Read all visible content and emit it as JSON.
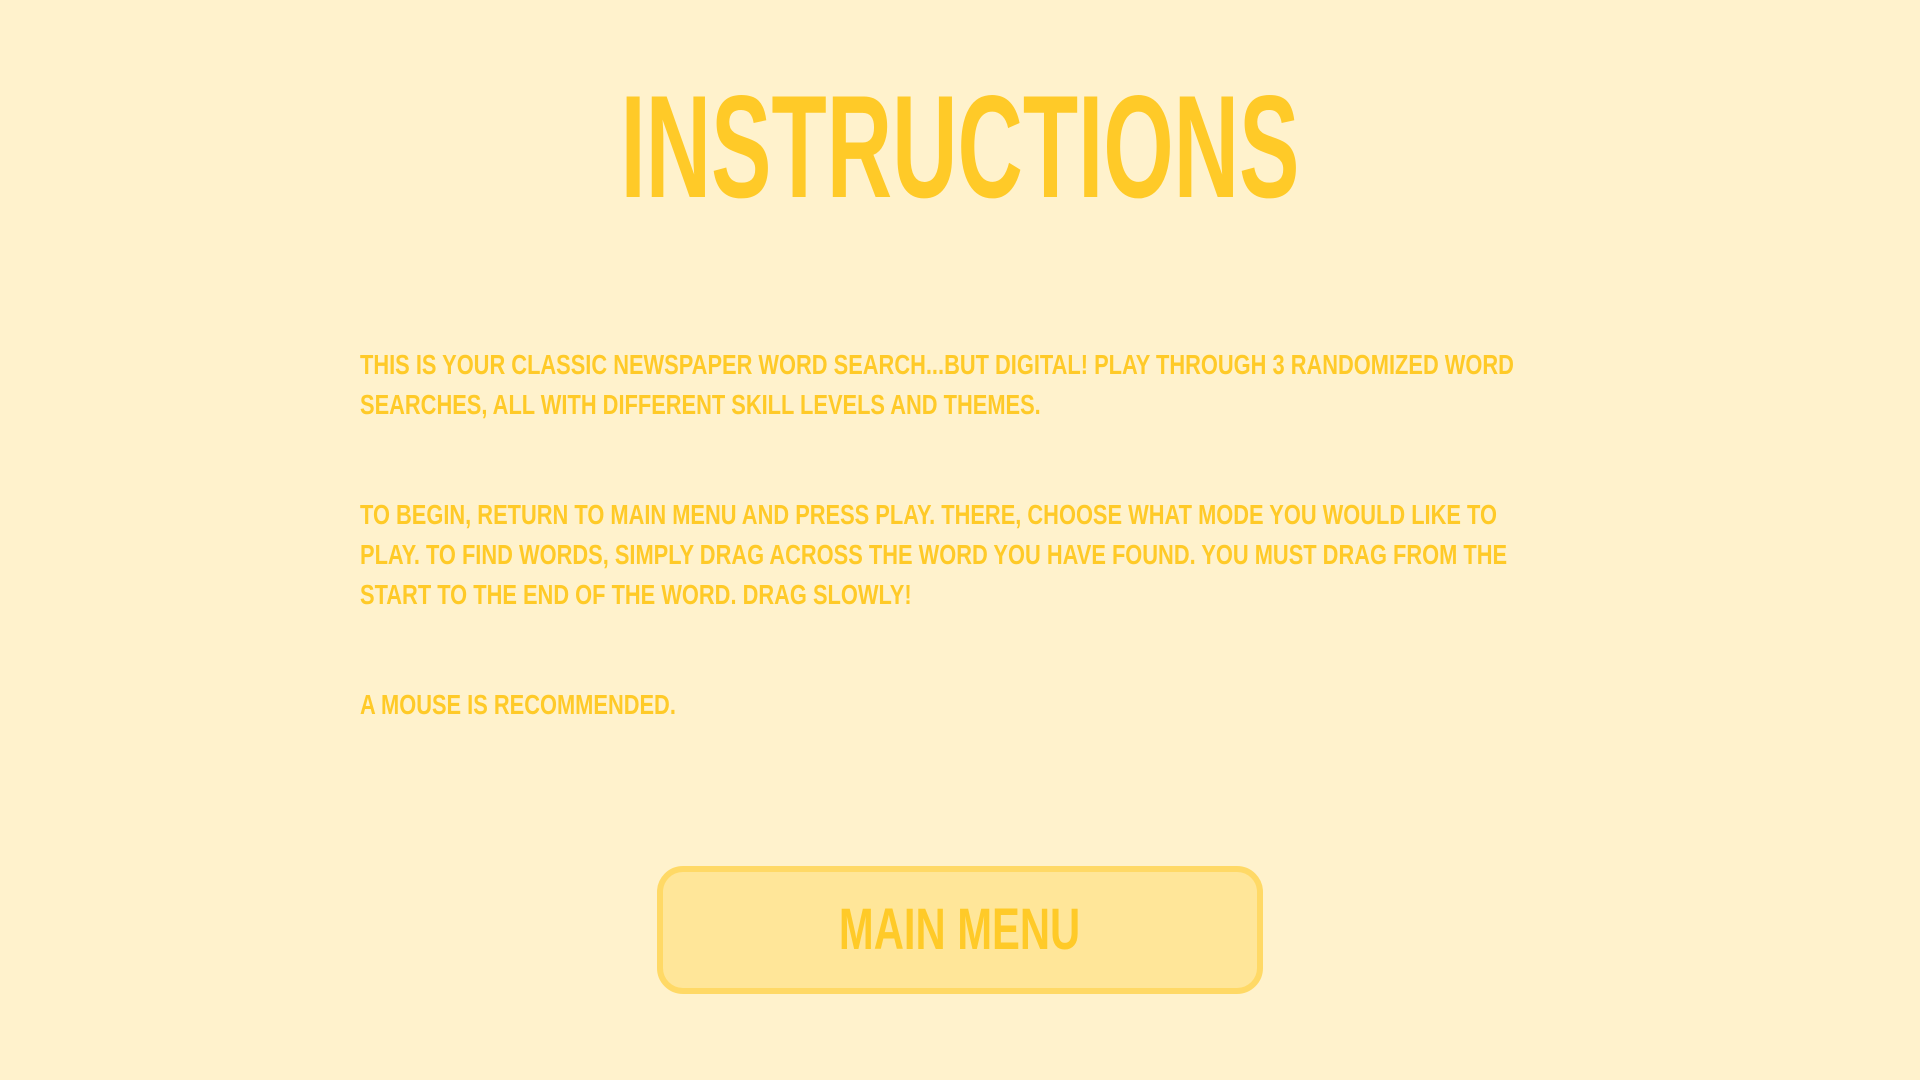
{
  "title": "Instructions",
  "paragraphs": [
    "This is your classic newspaper word search...but digital! Play through 3 randomized word searches, all with different skill levels and themes.",
    "To begin, return to main menu and press play. There, choose what mode you would like to play. To find words, simply drag across the word you have found. You must drag from the start to the end of the word. Drag slowly!",
    "A mouse is recommended."
  ],
  "main_menu_button": {
    "label": "Main Menu"
  },
  "colors": {
    "background": "#FFF2CC",
    "accent": "#FFCA28",
    "button_fill": "#FFE699",
    "button_border": "#FFD966"
  }
}
